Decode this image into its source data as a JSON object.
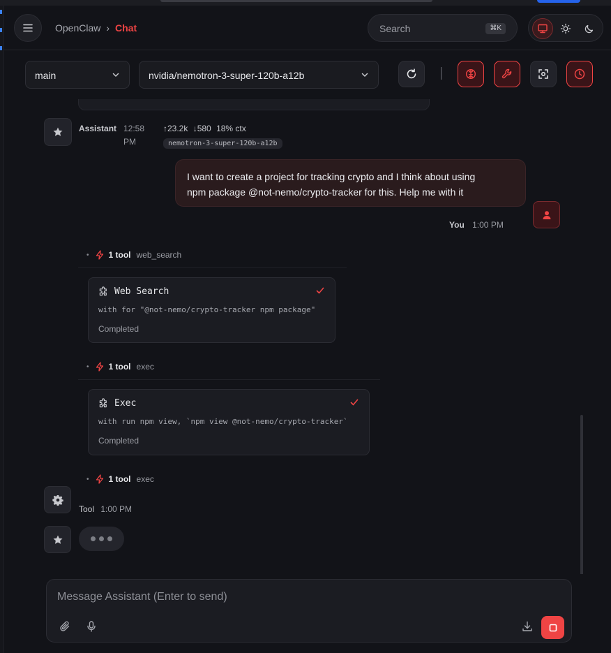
{
  "header": {
    "breadcrumb_parent": "OpenClaw",
    "breadcrumb_separator": "›",
    "breadcrumb_current": "Chat",
    "search_label": "Search",
    "search_shortcut": "⌘K",
    "theme_options": [
      "system",
      "light",
      "dark"
    ],
    "theme_selected": "system"
  },
  "toolbar": {
    "session_value": "main",
    "model_value": "nvidia/nemotron-3-super-120b-a12b",
    "separator": "|",
    "buttons": [
      "refresh-icon",
      "brain-icon",
      "wrench-icon",
      "focus-icon",
      "clock-icon"
    ]
  },
  "messages": {
    "assistant_meta": {
      "name": "Assistant",
      "time_line1": "12:58",
      "time_line2": "PM",
      "tokens_up": "↑23.2k",
      "tokens_down": "↓580",
      "ctx": "18% ctx",
      "model_tag": "nemotron-3-super-120b-a12b"
    },
    "user_message": {
      "line1": "I want to create a project for tracking crypto and I think about using",
      "line2": "npm package @not-nemo/crypto-tracker for this. Help me with it",
      "name": "You",
      "time": "1:00 PM"
    },
    "tool_groups": [
      {
        "dot": "•",
        "count": "1 tool",
        "name": "web_search",
        "card_title": "Web Search",
        "card_args": "with for \"@not-nemo/crypto-tracker npm package\"",
        "card_status": "Completed"
      },
      {
        "dot": "•",
        "count": "1 tool",
        "name": "exec",
        "card_title": "Exec",
        "card_args": "with run npm view, `npm view @not-nemo/crypto-tracker`",
        "card_status": "Completed"
      },
      {
        "dot": "•",
        "count": "1 tool",
        "name": "exec"
      }
    ],
    "tool_meta": {
      "name": "Tool",
      "time": "1:00 PM"
    }
  },
  "composer": {
    "placeholder": "Message Assistant (Enter to send)"
  },
  "colors": {
    "accent": "#ef4444",
    "background": "#121318",
    "surface": "#1b1c22",
    "user_bubble": "#2a1b1d"
  }
}
